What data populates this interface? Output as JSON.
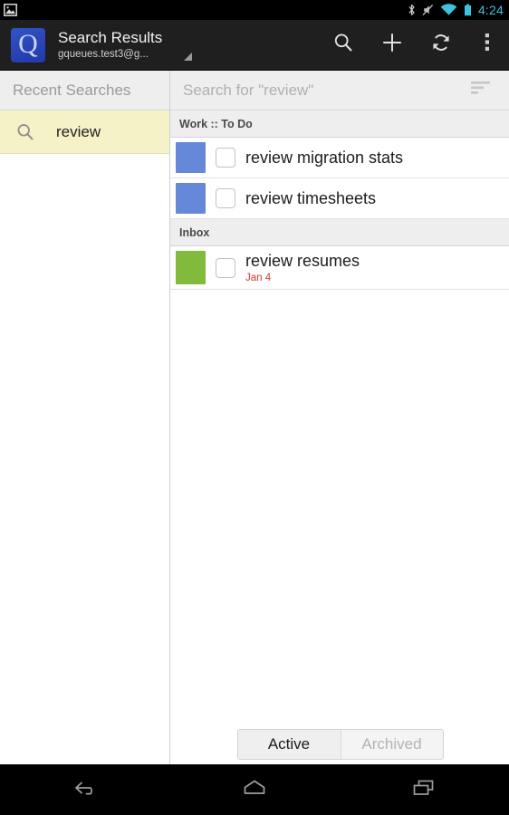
{
  "status_bar": {
    "time": "4:24",
    "icons": [
      "notification-image-icon",
      "bluetooth-icon",
      "vibrate-mute-icon",
      "wifi-icon",
      "battery-icon"
    ],
    "time_color": "#3fc1e0"
  },
  "action_bar": {
    "app_icon_letter": "Q",
    "title": "Search Results",
    "subtitle": "gqueues.test3@g...",
    "actions": [
      {
        "name": "search",
        "icon": "search-icon"
      },
      {
        "name": "add",
        "icon": "plus-icon"
      },
      {
        "name": "refresh",
        "icon": "refresh-icon"
      },
      {
        "name": "overflow",
        "icon": "overflow-menu-icon"
      }
    ]
  },
  "sidebar": {
    "header": "Recent Searches",
    "items": [
      {
        "label": "review",
        "icon": "search-icon",
        "selected": true
      }
    ]
  },
  "search": {
    "placeholder": "Search for \"review\"",
    "value": "",
    "sort_icon": "sort-filter-icon"
  },
  "sections": [
    {
      "header": "Work :: To Do",
      "tasks": [
        {
          "title": "review migration stats",
          "color": "#6688d8",
          "due": "",
          "checked": false
        },
        {
          "title": "review timesheets",
          "color": "#6688d8",
          "due": "",
          "checked": false
        }
      ]
    },
    {
      "header": "Inbox",
      "tasks": [
        {
          "title": "review resumes",
          "color": "#82ba3c",
          "due": "Jan 4",
          "checked": false
        }
      ]
    }
  ],
  "bottom_tabs": {
    "active_label": "Active",
    "archived_label": "Archived",
    "selected": "Active"
  },
  "nav_bar": {
    "buttons": [
      {
        "name": "back",
        "icon": "back-arrow-icon"
      },
      {
        "name": "home",
        "icon": "home-icon"
      },
      {
        "name": "recents",
        "icon": "recent-apps-icon"
      }
    ]
  },
  "colors": {
    "task_blue": "#6688d8",
    "task_green": "#82ba3c",
    "due_red": "#d03b2f",
    "highlight_yellow": "#f5f2c8",
    "accent_cyan": "#3fc1e0"
  }
}
